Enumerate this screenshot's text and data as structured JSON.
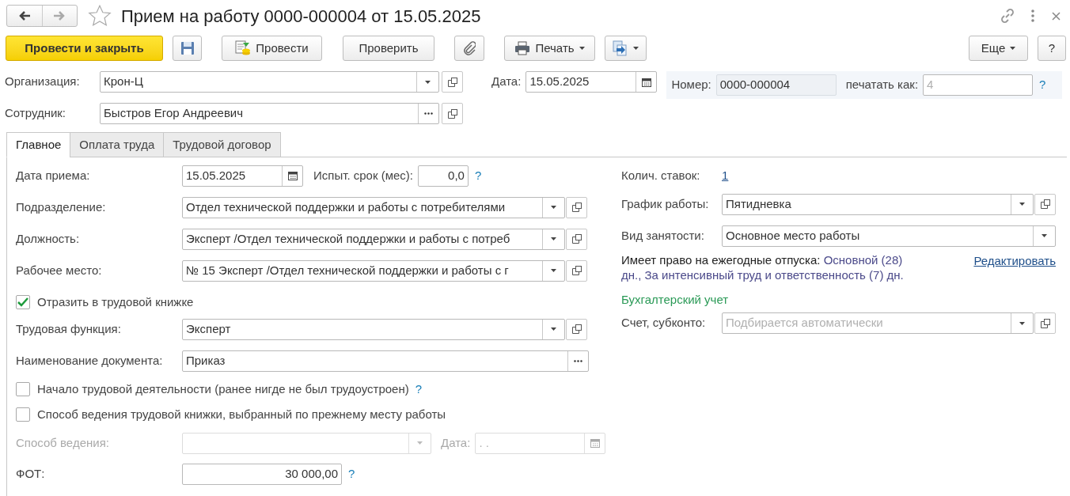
{
  "window": {
    "title": "Прием на работу 0000-000004 от 15.05.2025",
    "favorite": false
  },
  "toolbar": {
    "post_close": "Провести и закрыть",
    "post": "Провести",
    "check": "Проверить",
    "print": "Печать",
    "more": "Еще",
    "help": "?"
  },
  "header": {
    "organization": {
      "label": "Организация:",
      "value": "Крон-Ц"
    },
    "employee": {
      "label": "Сотрудник:",
      "value": "Быстров Егор Андреевич"
    },
    "date": {
      "label": "Дата:",
      "value": "15.05.2025"
    },
    "number": {
      "label": "Номер:",
      "value": "0000-000004"
    },
    "print_as": {
      "label": "печатать как:",
      "placeholder": "4",
      "help": "?"
    }
  },
  "tabs": [
    {
      "label": "Главное",
      "selected": true
    },
    {
      "label": "Оплата труда",
      "selected": false
    },
    {
      "label": "Трудовой договор",
      "selected": false
    }
  ],
  "main": {
    "hire_date": {
      "label": "Дата приема:",
      "value": "15.05.2025"
    },
    "probation": {
      "label": "Испыт. срок (мес):",
      "value": "0,0",
      "help": "?"
    },
    "department": {
      "label": "Подразделение:",
      "value": "Отдел технической поддержки и работы с потребителями"
    },
    "position": {
      "label": "Должность:",
      "value": "Эксперт /Отдел технической поддержки и работы с потреб"
    },
    "workplace": {
      "label": "Рабочее место:",
      "value": "№ 15 Эксперт /Отдел технической поддержки и работы с г"
    },
    "record_in_book": {
      "label": "Отразить в трудовой книжке",
      "checked": true
    },
    "labor_function": {
      "label": "Трудовая функция:",
      "value": "Эксперт"
    },
    "document_name": {
      "label": "Наименование документа:",
      "value": "Приказ"
    },
    "first_job": {
      "label": "Начало трудовой деятельности (ранее нигде не был трудоустроен)",
      "checked": false,
      "help": "?"
    },
    "book_method_prev": {
      "label": "Способ ведения трудовой книжки, выбранный по прежнему месту работы",
      "checked": false
    },
    "method": {
      "label": "Способ ведения:",
      "disabled": true
    },
    "method_date": {
      "label": "Дата:",
      "placeholder": ". .",
      "disabled": true
    },
    "payroll": {
      "label": "ФОТ:",
      "value": "30 000,00",
      "help": "?"
    }
  },
  "side": {
    "rates": {
      "label": "Колич. ставок:",
      "value": "1"
    },
    "schedule": {
      "label": "График работы:",
      "value": "Пятидневка"
    },
    "employment_type": {
      "label": "Вид занятости:",
      "value": "Основное место работы"
    },
    "vacations": {
      "label": "Имеет право на ежегодные отпуска:",
      "value": "Основной (28) дн., За интенсивный труд и ответственность (7) дн.",
      "edit_link": "Редактировать"
    },
    "accounting": {
      "title": "Бухгалтерский учет",
      "label": "Счет, субконто:",
      "placeholder": "Подбирается автоматически"
    }
  }
}
